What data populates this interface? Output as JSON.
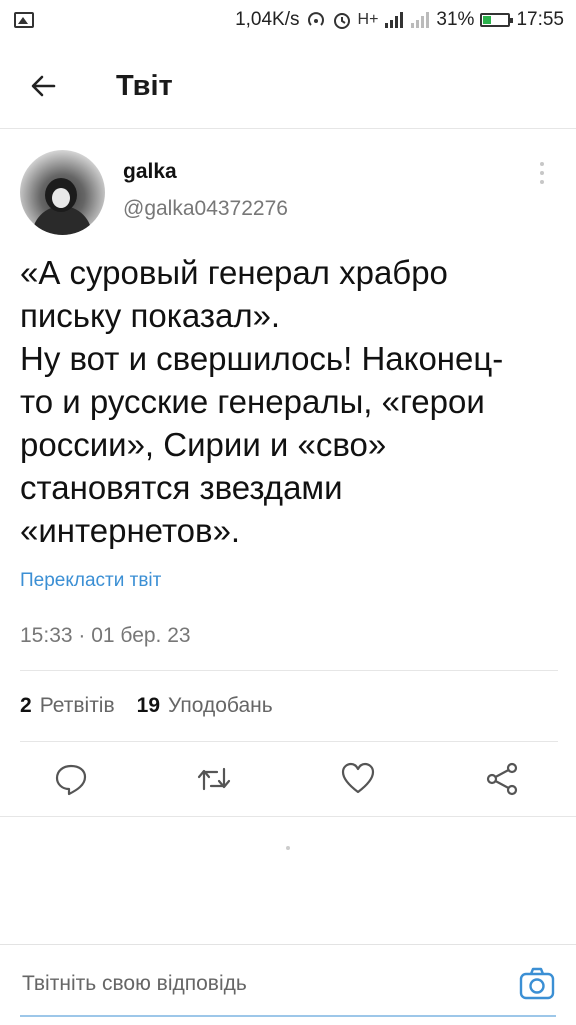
{
  "status_bar": {
    "speed": "1,04K/s",
    "network_label": "H+",
    "battery_percent": "31%",
    "battery_level": 0.31,
    "time": "17:55"
  },
  "header": {
    "title": "Твіт"
  },
  "tweet": {
    "username": "galka",
    "handle": "@galka04372276",
    "text_lines": [
      "«А суровый генерал храбро",
      "письку показал».",
      "Ну вот и свершилось! Наконец-",
      "то и русские генералы, «герои",
      "россии», Сирии и «сво»",
      "становятся звездами",
      "«интернетов»."
    ],
    "translate_label": "Перекласти твіт",
    "timestamp": "15:33 · 01 бер. 23",
    "retweets_count": "2",
    "retweets_label": "Ретвітів",
    "likes_count": "19",
    "likes_label": "Уподобань"
  },
  "actions": [
    "reply-icon",
    "retweet-icon",
    "like-icon",
    "share-icon"
  ],
  "reply_bar": {
    "placeholder": "Твітніть свою відповідь"
  },
  "colors": {
    "link": "#3b8fd4",
    "battery": "#2bb24c"
  }
}
